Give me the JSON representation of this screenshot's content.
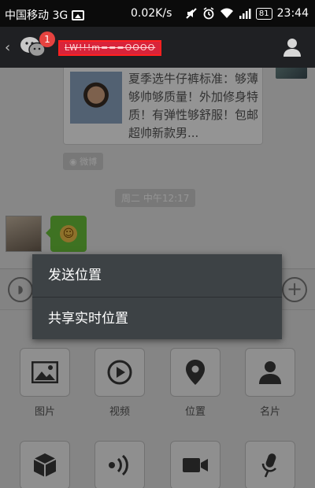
{
  "status_bar": {
    "carrier": "中国移动 3G",
    "speed": "0.02K/s",
    "battery": "81",
    "time": "23:44"
  },
  "header": {
    "unread_badge": "1",
    "contact_name": "LW!!!m===OOOO"
  },
  "chat": {
    "news_text": "夏季选牛仔裤标准：够薄够帅够质量！外加修身特质！有弹性够舒服！包邮超帅新款男...",
    "source_tag": "微博",
    "timestamp": "周二 中午12:17"
  },
  "context_menu": {
    "items": [
      {
        "label": "发送位置"
      },
      {
        "label": "共享实时位置"
      }
    ]
  },
  "panel": {
    "tools": [
      {
        "label": "图片",
        "icon": "image-icon"
      },
      {
        "label": "视频",
        "icon": "video-icon"
      },
      {
        "label": "位置",
        "icon": "location-icon"
      },
      {
        "label": "名片",
        "icon": "contact-card-icon"
      }
    ],
    "tools_row2": [
      {
        "icon": "cube-icon"
      },
      {
        "icon": "voice-input-icon"
      },
      {
        "icon": "video-call-icon"
      },
      {
        "icon": "microphone-icon"
      }
    ]
  }
}
